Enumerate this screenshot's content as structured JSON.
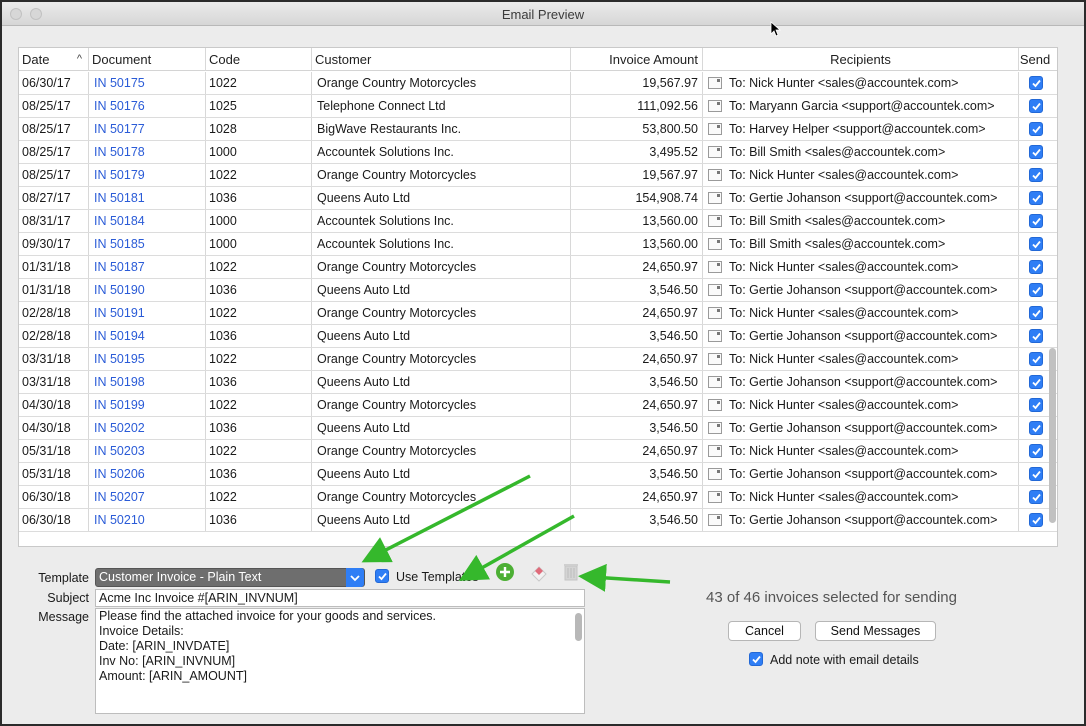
{
  "window": {
    "title": "Email Preview"
  },
  "table": {
    "columns": {
      "date": "Date",
      "document": "Document",
      "code": "Code",
      "customer": "Customer",
      "amount": "Invoice Amount",
      "recipients": "Recipients",
      "send": "Send"
    },
    "sort_caret": "^",
    "rows": [
      {
        "date": "06/30/17",
        "doc": "IN 50175",
        "code": "1022",
        "customer": "Orange Country Motorcycles",
        "amount": "19,567.97",
        "recipient": "To: Nick Hunter <sales@accountek.com>",
        "send": true
      },
      {
        "date": "08/25/17",
        "doc": "IN 50176",
        "code": "1025",
        "customer": "Telephone Connect Ltd",
        "amount": "111,092.56",
        "recipient": "To: Maryann Garcia <support@accountek.com>",
        "send": true
      },
      {
        "date": "08/25/17",
        "doc": "IN 50177",
        "code": "1028",
        "customer": "BigWave Restaurants Inc.",
        "amount": "53,800.50",
        "recipient": "To: Harvey Helper <support@accountek.com>",
        "send": true
      },
      {
        "date": "08/25/17",
        "doc": "IN 50178",
        "code": "1000",
        "customer": "Accountek Solutions Inc.",
        "amount": "3,495.52",
        "recipient": "To: Bill Smith <sales@accountek.com>",
        "send": true
      },
      {
        "date": "08/25/17",
        "doc": "IN 50179",
        "code": "1022",
        "customer": "Orange Country Motorcycles",
        "amount": "19,567.97",
        "recipient": "To: Nick Hunter <sales@accountek.com>",
        "send": true
      },
      {
        "date": "08/27/17",
        "doc": "IN 50181",
        "code": "1036",
        "customer": "Queens Auto Ltd",
        "amount": "154,908.74",
        "recipient": "To: Gertie Johanson <support@accountek.com>",
        "send": true
      },
      {
        "date": "08/31/17",
        "doc": "IN 50184",
        "code": "1000",
        "customer": "Accountek Solutions Inc.",
        "amount": "13,560.00",
        "recipient": "To: Bill Smith <sales@accountek.com>",
        "send": true
      },
      {
        "date": "09/30/17",
        "doc": "IN 50185",
        "code": "1000",
        "customer": "Accountek Solutions Inc.",
        "amount": "13,560.00",
        "recipient": "To: Bill Smith <sales@accountek.com>",
        "send": true
      },
      {
        "date": "01/31/18",
        "doc": "IN 50187",
        "code": "1022",
        "customer": "Orange Country Motorcycles",
        "amount": "24,650.97",
        "recipient": "To: Nick Hunter <sales@accountek.com>",
        "send": true
      },
      {
        "date": "01/31/18",
        "doc": "IN 50190",
        "code": "1036",
        "customer": "Queens Auto Ltd",
        "amount": "3,546.50",
        "recipient": "To: Gertie Johanson <support@accountek.com>",
        "send": true
      },
      {
        "date": "02/28/18",
        "doc": "IN 50191",
        "code": "1022",
        "customer": "Orange Country Motorcycles",
        "amount": "24,650.97",
        "recipient": "To: Nick Hunter <sales@accountek.com>",
        "send": true
      },
      {
        "date": "02/28/18",
        "doc": "IN 50194",
        "code": "1036",
        "customer": "Queens Auto Ltd",
        "amount": "3,546.50",
        "recipient": "To: Gertie Johanson <support@accountek.com>",
        "send": true
      },
      {
        "date": "03/31/18",
        "doc": "IN 50195",
        "code": "1022",
        "customer": "Orange Country Motorcycles",
        "amount": "24,650.97",
        "recipient": "To: Nick Hunter <sales@accountek.com>",
        "send": true
      },
      {
        "date": "03/31/18",
        "doc": "IN 50198",
        "code": "1036",
        "customer": "Queens Auto Ltd",
        "amount": "3,546.50",
        "recipient": "To: Gertie Johanson <support@accountek.com>",
        "send": true
      },
      {
        "date": "04/30/18",
        "doc": "IN 50199",
        "code": "1022",
        "customer": "Orange Country Motorcycles",
        "amount": "24,650.97",
        "recipient": "To: Nick Hunter <sales@accountek.com>",
        "send": true
      },
      {
        "date": "04/30/18",
        "doc": "IN 50202",
        "code": "1036",
        "customer": "Queens Auto Ltd",
        "amount": "3,546.50",
        "recipient": "To: Gertie Johanson <support@accountek.com>",
        "send": true
      },
      {
        "date": "05/31/18",
        "doc": "IN 50203",
        "code": "1022",
        "customer": "Orange Country Motorcycles",
        "amount": "24,650.97",
        "recipient": "To: Nick Hunter <sales@accountek.com>",
        "send": true
      },
      {
        "date": "05/31/18",
        "doc": "IN 50206",
        "code": "1036",
        "customer": "Queens Auto Ltd",
        "amount": "3,546.50",
        "recipient": "To: Gertie Johanson <support@accountek.com>",
        "send": true
      },
      {
        "date": "06/30/18",
        "doc": "IN 50207",
        "code": "1022",
        "customer": "Orange Country Motorcycles",
        "amount": "24,650.97",
        "recipient": "To: Nick Hunter <sales@accountek.com>",
        "send": true
      },
      {
        "date": "06/30/18",
        "doc": "IN 50210",
        "code": "1036",
        "customer": "Queens Auto Ltd",
        "amount": "3,546.50",
        "recipient": "To: Gertie Johanson <support@accountek.com>",
        "send": true
      }
    ]
  },
  "form": {
    "template_label": "Template",
    "template_value": "Customer Invoice - Plain Text",
    "use_templates_label": "Use Templates",
    "use_templates_checked": true,
    "subject_label": "Subject",
    "subject_value": "Acme Inc Invoice #[ARIN_INVNUM]",
    "message_label": "Message",
    "message_lines": [
      "Please find the attached invoice for your goods and services.",
      "",
      "Invoice Details:",
      "",
      "Date: [ARIN_INVDATE]",
      "Inv No: [ARIN_INVNUM]",
      "Amount: [ARIN_AMOUNT]"
    ],
    "icons": [
      "add-template-icon",
      "eraser-icon",
      "trash-icon"
    ]
  },
  "actions": {
    "status": "43 of 46 invoices selected for sending",
    "cancel_label": "Cancel",
    "send_label": "Send Messages",
    "add_note_label": "Add note with email details",
    "add_note_checked": true
  },
  "colors": {
    "link": "#2a5bd7",
    "check_blue": "#2f7ef5",
    "annotation_arrow": "#35b82c",
    "add_icon": "#4caf34",
    "eraser": "#e06b7a"
  }
}
